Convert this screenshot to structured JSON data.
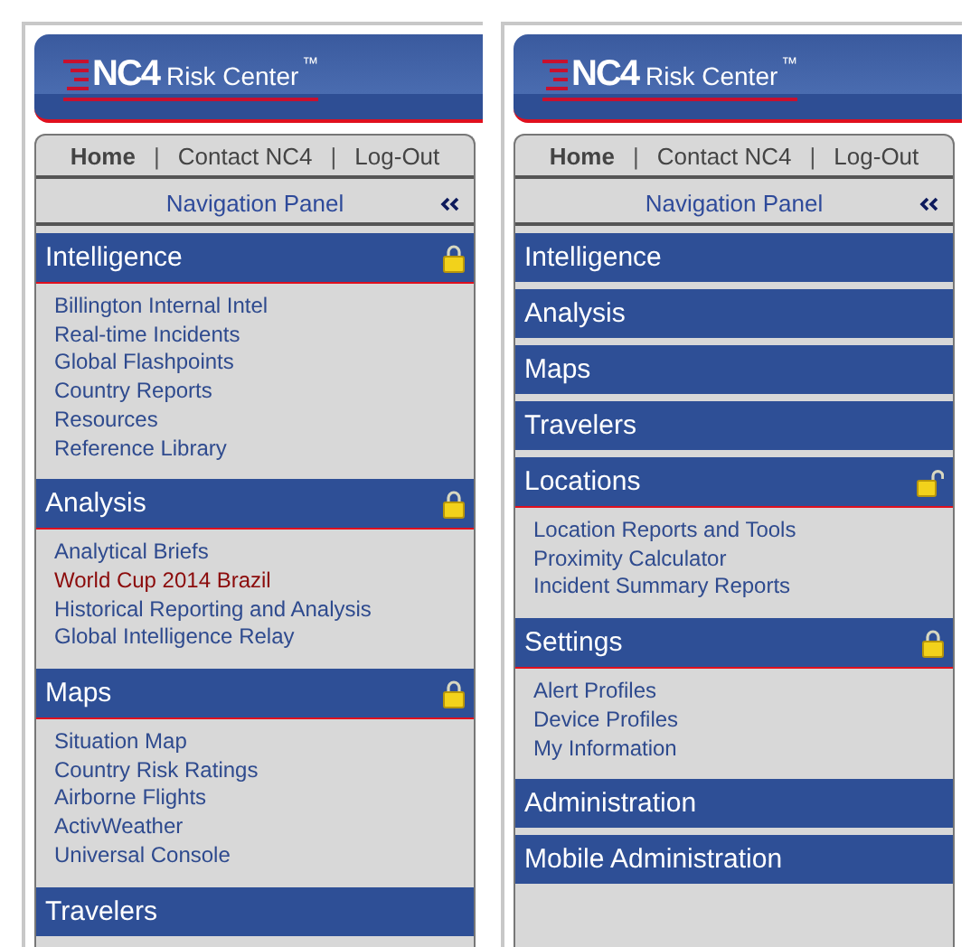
{
  "panels": [
    {
      "logo": {
        "mark": "NC4",
        "name": "Risk Center",
        "trademark": "™"
      },
      "top_links": [
        {
          "label": "Home",
          "selected": true
        },
        {
          "label": "Contact NC4",
          "selected": false
        },
        {
          "label": "Log-Out",
          "selected": false
        }
      ],
      "separator": "|",
      "panel_title": "Navigation Panel",
      "sections": [
        {
          "title": "Intelligence",
          "expanded": true,
          "has_lock": true,
          "locked": true,
          "items": [
            {
              "label": "Billington Internal Intel",
              "highlighted": false
            },
            {
              "label": "Real-time Incidents",
              "highlighted": false
            },
            {
              "label": "Global Flashpoints",
              "highlighted": false
            },
            {
              "label": "Country Reports",
              "highlighted": false
            },
            {
              "label": "Resources",
              "highlighted": false
            },
            {
              "label": "Reference Library",
              "highlighted": false
            }
          ]
        },
        {
          "title": "Analysis",
          "expanded": true,
          "has_lock": true,
          "locked": true,
          "items": [
            {
              "label": "Analytical Briefs",
              "highlighted": false
            },
            {
              "label": "World Cup 2014 Brazil",
              "highlighted": true
            },
            {
              "label": "Historical Reporting and Analysis",
              "highlighted": false
            },
            {
              "label": "Global Intelligence Relay",
              "highlighted": false
            }
          ]
        },
        {
          "title": "Maps",
          "expanded": true,
          "has_lock": true,
          "locked": true,
          "items": [
            {
              "label": "Situation Map",
              "highlighted": false
            },
            {
              "label": "Country Risk Ratings",
              "highlighted": false
            },
            {
              "label": "Airborne Flights",
              "highlighted": false
            },
            {
              "label": "ActivWeather",
              "highlighted": false
            },
            {
              "label": "Universal Console",
              "highlighted": false
            }
          ]
        },
        {
          "title": "Travelers",
          "expanded": false,
          "has_lock": false
        }
      ]
    },
    {
      "logo": {
        "mark": "NC4",
        "name": "Risk Center",
        "trademark": "™"
      },
      "top_links": [
        {
          "label": "Home",
          "selected": true
        },
        {
          "label": "Contact NC4",
          "selected": false
        },
        {
          "label": "Log-Out",
          "selected": false
        }
      ],
      "separator": "|",
      "panel_title": "Navigation Panel",
      "sections": [
        {
          "title": "Intelligence",
          "expanded": false,
          "has_lock": false
        },
        {
          "title": "Analysis",
          "expanded": false,
          "has_lock": false
        },
        {
          "title": "Maps",
          "expanded": false,
          "has_lock": false
        },
        {
          "title": "Travelers",
          "expanded": false,
          "has_lock": false
        },
        {
          "title": "Locations",
          "expanded": true,
          "has_lock": true,
          "locked": false,
          "items": [
            {
              "label": "Location Reports and Tools",
              "highlighted": false
            },
            {
              "label": "Proximity Calculator",
              "highlighted": false
            },
            {
              "label": "Incident Summary Reports",
              "highlighted": false
            }
          ]
        },
        {
          "title": "Settings",
          "expanded": true,
          "has_lock": true,
          "locked": true,
          "items": [
            {
              "label": "Alert Profiles",
              "highlighted": false
            },
            {
              "label": "Device Profiles",
              "highlighted": false
            },
            {
              "label": "My Information",
              "highlighted": false
            }
          ]
        },
        {
          "title": "Administration",
          "expanded": false,
          "has_lock": false
        },
        {
          "title": "Mobile Administration",
          "expanded": false,
          "has_lock": false
        }
      ]
    }
  ]
}
